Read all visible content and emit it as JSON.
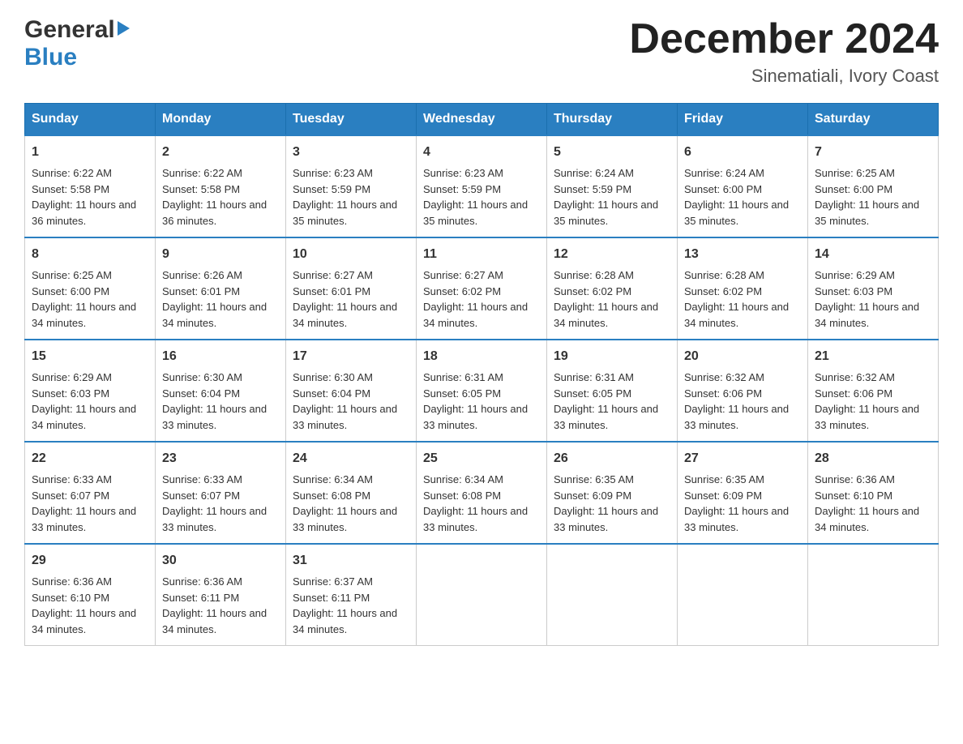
{
  "header": {
    "logo_general": "General",
    "logo_blue": "Blue",
    "month_title": "December 2024",
    "location": "Sinematiali, Ivory Coast"
  },
  "days_of_week": [
    "Sunday",
    "Monday",
    "Tuesday",
    "Wednesday",
    "Thursday",
    "Friday",
    "Saturday"
  ],
  "weeks": [
    [
      {
        "day": "1",
        "sunrise": "6:22 AM",
        "sunset": "5:58 PM",
        "daylight": "11 hours and 36 minutes."
      },
      {
        "day": "2",
        "sunrise": "6:22 AM",
        "sunset": "5:58 PM",
        "daylight": "11 hours and 36 minutes."
      },
      {
        "day": "3",
        "sunrise": "6:23 AM",
        "sunset": "5:59 PM",
        "daylight": "11 hours and 35 minutes."
      },
      {
        "day": "4",
        "sunrise": "6:23 AM",
        "sunset": "5:59 PM",
        "daylight": "11 hours and 35 minutes."
      },
      {
        "day": "5",
        "sunrise": "6:24 AM",
        "sunset": "5:59 PM",
        "daylight": "11 hours and 35 minutes."
      },
      {
        "day": "6",
        "sunrise": "6:24 AM",
        "sunset": "6:00 PM",
        "daylight": "11 hours and 35 minutes."
      },
      {
        "day": "7",
        "sunrise": "6:25 AM",
        "sunset": "6:00 PM",
        "daylight": "11 hours and 35 minutes."
      }
    ],
    [
      {
        "day": "8",
        "sunrise": "6:25 AM",
        "sunset": "6:00 PM",
        "daylight": "11 hours and 34 minutes."
      },
      {
        "day": "9",
        "sunrise": "6:26 AM",
        "sunset": "6:01 PM",
        "daylight": "11 hours and 34 minutes."
      },
      {
        "day": "10",
        "sunrise": "6:27 AM",
        "sunset": "6:01 PM",
        "daylight": "11 hours and 34 minutes."
      },
      {
        "day": "11",
        "sunrise": "6:27 AM",
        "sunset": "6:02 PM",
        "daylight": "11 hours and 34 minutes."
      },
      {
        "day": "12",
        "sunrise": "6:28 AM",
        "sunset": "6:02 PM",
        "daylight": "11 hours and 34 minutes."
      },
      {
        "day": "13",
        "sunrise": "6:28 AM",
        "sunset": "6:02 PM",
        "daylight": "11 hours and 34 minutes."
      },
      {
        "day": "14",
        "sunrise": "6:29 AM",
        "sunset": "6:03 PM",
        "daylight": "11 hours and 34 minutes."
      }
    ],
    [
      {
        "day": "15",
        "sunrise": "6:29 AM",
        "sunset": "6:03 PM",
        "daylight": "11 hours and 34 minutes."
      },
      {
        "day": "16",
        "sunrise": "6:30 AM",
        "sunset": "6:04 PM",
        "daylight": "11 hours and 33 minutes."
      },
      {
        "day": "17",
        "sunrise": "6:30 AM",
        "sunset": "6:04 PM",
        "daylight": "11 hours and 33 minutes."
      },
      {
        "day": "18",
        "sunrise": "6:31 AM",
        "sunset": "6:05 PM",
        "daylight": "11 hours and 33 minutes."
      },
      {
        "day": "19",
        "sunrise": "6:31 AM",
        "sunset": "6:05 PM",
        "daylight": "11 hours and 33 minutes."
      },
      {
        "day": "20",
        "sunrise": "6:32 AM",
        "sunset": "6:06 PM",
        "daylight": "11 hours and 33 minutes."
      },
      {
        "day": "21",
        "sunrise": "6:32 AM",
        "sunset": "6:06 PM",
        "daylight": "11 hours and 33 minutes."
      }
    ],
    [
      {
        "day": "22",
        "sunrise": "6:33 AM",
        "sunset": "6:07 PM",
        "daylight": "11 hours and 33 minutes."
      },
      {
        "day": "23",
        "sunrise": "6:33 AM",
        "sunset": "6:07 PM",
        "daylight": "11 hours and 33 minutes."
      },
      {
        "day": "24",
        "sunrise": "6:34 AM",
        "sunset": "6:08 PM",
        "daylight": "11 hours and 33 minutes."
      },
      {
        "day": "25",
        "sunrise": "6:34 AM",
        "sunset": "6:08 PM",
        "daylight": "11 hours and 33 minutes."
      },
      {
        "day": "26",
        "sunrise": "6:35 AM",
        "sunset": "6:09 PM",
        "daylight": "11 hours and 33 minutes."
      },
      {
        "day": "27",
        "sunrise": "6:35 AM",
        "sunset": "6:09 PM",
        "daylight": "11 hours and 33 minutes."
      },
      {
        "day": "28",
        "sunrise": "6:36 AM",
        "sunset": "6:10 PM",
        "daylight": "11 hours and 34 minutes."
      }
    ],
    [
      {
        "day": "29",
        "sunrise": "6:36 AM",
        "sunset": "6:10 PM",
        "daylight": "11 hours and 34 minutes."
      },
      {
        "day": "30",
        "sunrise": "6:36 AM",
        "sunset": "6:11 PM",
        "daylight": "11 hours and 34 minutes."
      },
      {
        "day": "31",
        "sunrise": "6:37 AM",
        "sunset": "6:11 PM",
        "daylight": "11 hours and 34 minutes."
      },
      null,
      null,
      null,
      null
    ]
  ],
  "labels": {
    "sunrise": "Sunrise:",
    "sunset": "Sunset:",
    "daylight": "Daylight:"
  }
}
